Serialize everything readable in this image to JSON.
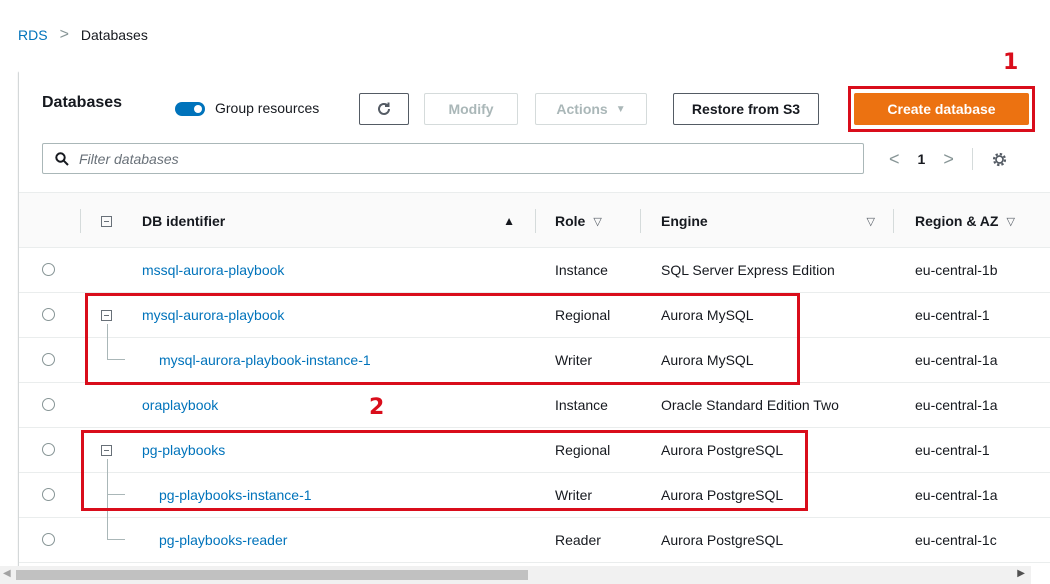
{
  "breadcrumb": {
    "root": "RDS",
    "separator": ">",
    "current": "Databases"
  },
  "header": {
    "title": "Databases",
    "group_resources_label": "Group resources",
    "modify_label": "Modify",
    "actions_label": "Actions",
    "restore_label": "Restore from S3",
    "create_label": "Create database"
  },
  "search": {
    "placeholder": "Filter databases"
  },
  "pager": {
    "prev": "<",
    "page": "1",
    "next": ">"
  },
  "columns": {
    "identifier": "DB identifier",
    "role": "Role",
    "engine": "Engine",
    "region": "Region & AZ"
  },
  "rows": [
    {
      "id": "mssql-aurora-playbook",
      "role": "Instance",
      "engine": "SQL Server Express Edition",
      "region": "eu-central-1b"
    },
    {
      "id": "mysql-aurora-playbook",
      "role": "Regional",
      "engine": "Aurora MySQL",
      "region": "eu-central-1"
    },
    {
      "id": "mysql-aurora-playbook-instance-1",
      "role": "Writer",
      "engine": "Aurora MySQL",
      "region": "eu-central-1a"
    },
    {
      "id": "oraplaybook",
      "role": "Instance",
      "engine": "Oracle Standard Edition Two",
      "region": "eu-central-1a"
    },
    {
      "id": "pg-playbooks",
      "role": "Regional",
      "engine": "Aurora PostgreSQL",
      "region": "eu-central-1"
    },
    {
      "id": "pg-playbooks-instance-1",
      "role": "Writer",
      "engine": "Aurora PostgreSQL",
      "region": "eu-central-1a"
    },
    {
      "id": "pg-playbooks-reader",
      "role": "Reader",
      "engine": "Aurora PostgreSQL",
      "region": "eu-central-1c"
    }
  ],
  "annotations": {
    "one": "1",
    "two": "2"
  },
  "colors": {
    "accent": "#0073bb",
    "primary": "#ec7211",
    "annotation": "#d90d1b"
  },
  "icons": [
    "refresh-icon",
    "caret-down-icon",
    "search-icon",
    "gear-icon",
    "sort-asc-icon",
    "sort-desc-icon",
    "collapse-icon"
  ]
}
